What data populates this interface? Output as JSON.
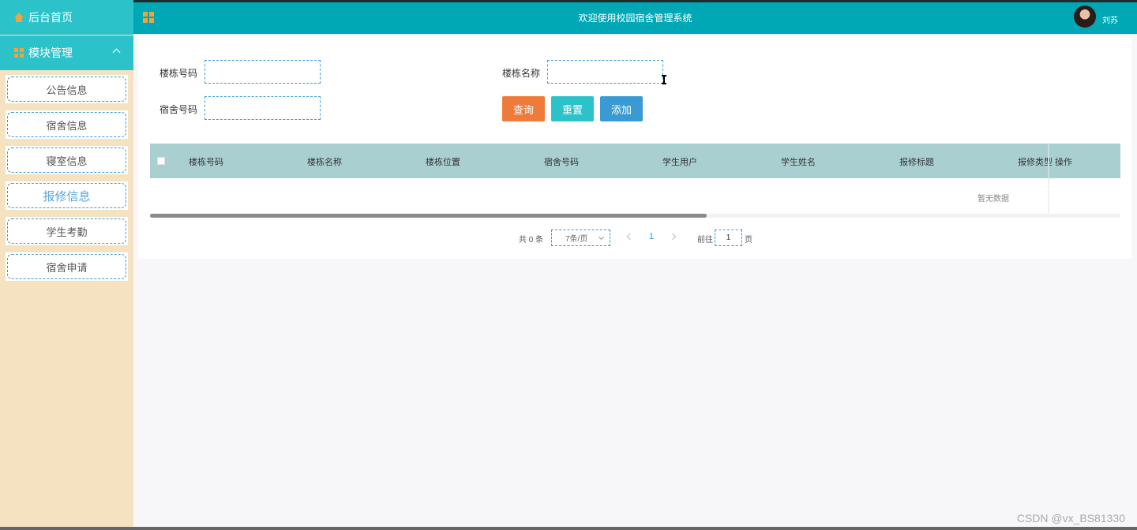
{
  "sidebar": {
    "home_label": "后台首页",
    "group_label": "模块管理",
    "items": [
      {
        "label": "公告信息",
        "active": false
      },
      {
        "label": "宿舍信息",
        "active": false
      },
      {
        "label": "寝室信息",
        "active": false
      },
      {
        "label": "报修信息",
        "active": true
      },
      {
        "label": "学生考勤",
        "active": false
      },
      {
        "label": "宿舍申请",
        "active": false
      }
    ]
  },
  "header": {
    "title": "欢迎使用校园宿舍管理系统",
    "username": "刘苏"
  },
  "search": {
    "building_no_label": "楼栋号码",
    "building_name_label": "楼栋名称",
    "room_no_label": "宿舍号码",
    "building_no_value": "",
    "building_name_value": "",
    "room_no_value": ""
  },
  "buttons": {
    "query": "查询",
    "reset": "重置",
    "add": "添加"
  },
  "table": {
    "columns": [
      "楼栋号码",
      "楼栋名称",
      "楼栋位置",
      "宿舍号码",
      "学生用户",
      "学生姓名",
      "报修标题",
      "报修类型",
      "操作"
    ],
    "empty_text": "暂无数据"
  },
  "pagination": {
    "total": "共 0 条",
    "page_size": "7条/页",
    "current": "1",
    "goto_label": "前往",
    "goto_value": "1",
    "page_suffix": "页"
  },
  "watermark": "CSDN @vx_BS81330",
  "colors": {
    "sidebar_bg": "#f4e2c0",
    "accent": "#2cc2c9",
    "header_bg": "#00a8b5",
    "query": "#ef7b3b",
    "add": "#3a9bd4",
    "table_head": "#a9cfd1"
  }
}
